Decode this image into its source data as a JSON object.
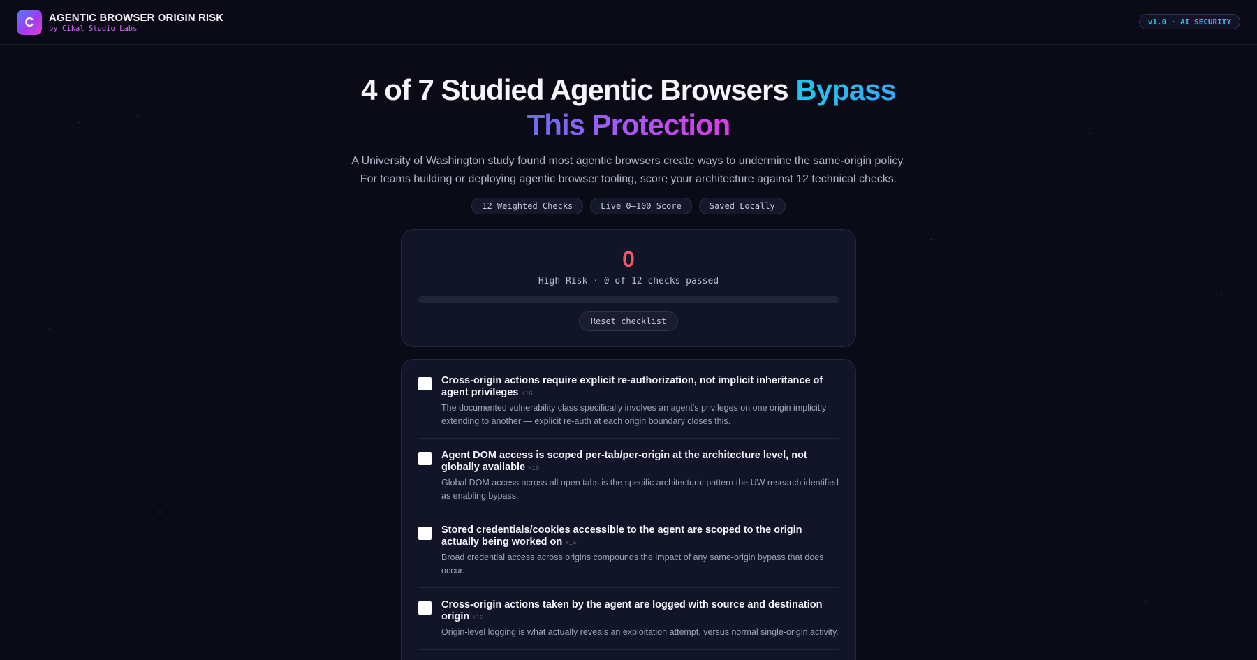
{
  "header": {
    "logo_letter": "C",
    "title": "AGENTIC BROWSER ORIGIN RISK",
    "subtitle": "by Cikal Studio Labs",
    "version_badge": "v1.0 · AI SECURITY"
  },
  "hero": {
    "headline_plain": "4 of 7 Studied Agentic Browsers ",
    "headline_accent_1": "Bypass",
    "headline_accent_2": "This Protection",
    "sub_line_1": "A University of Washington study found most agentic browsers create ways to undermine the same-origin policy.",
    "sub_line_2": "For teams building or deploying agentic browser tooling, score your architecture against 12 technical checks.",
    "chips": [
      "12 Weighted Checks",
      "Live 0–100 Score",
      "Saved Locally"
    ]
  },
  "score": {
    "value": "0",
    "status": "High Risk · 0 of 12 checks passed",
    "progress_fraction": 0,
    "reset_label": "Reset checklist"
  },
  "checklist": {
    "items": [
      {
        "title": "Cross-origin actions require explicit re-authorization, not implicit inheritance of agent privileges",
        "weight": "+16",
        "description": "The documented vulnerability class specifically involves an agent's privileges on one origin implicitly extending to another — explicit re-auth at each origin boundary closes this.",
        "checked": false
      },
      {
        "title": "Agent DOM access is scoped per-tab/per-origin at the architecture level, not globally available",
        "weight": "+16",
        "description": "Global DOM access across all open tabs is the specific architectural pattern the UW research identified as enabling bypass.",
        "checked": false
      },
      {
        "title": "Stored credentials/cookies accessible to the agent are scoped to the origin actually being worked on",
        "weight": "+14",
        "description": "Broad credential access across origins compounds the impact of any same-origin bypass that does occur.",
        "checked": false
      },
      {
        "title": "Cross-origin actions taken by the agent are logged with source and destination origin",
        "weight": "+12",
        "description": "Origin-level logging is what actually reveals an exploitation attempt, versus normal single-origin activity.",
        "checked": false
      }
    ]
  }
}
